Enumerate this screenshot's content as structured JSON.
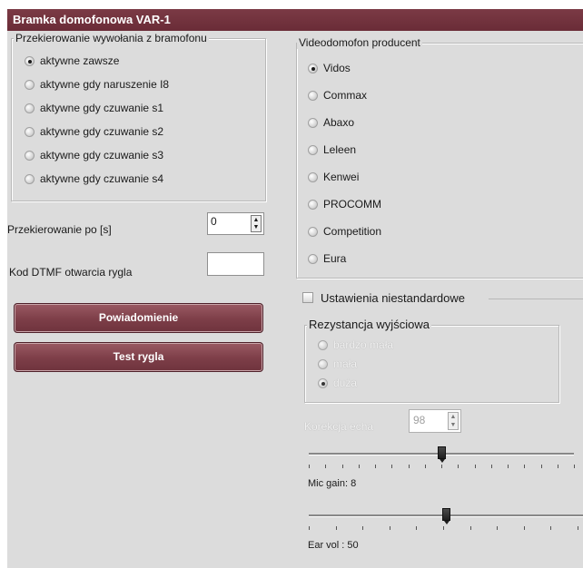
{
  "window": {
    "title": "Bramka domofonowa VAR-1"
  },
  "forwarding": {
    "legend": "Przekierowanie wywołania z bramofonu",
    "options": [
      {
        "label": "aktywne zawsze",
        "selected": true
      },
      {
        "label": "aktywne gdy naruszenie I8",
        "selected": false
      },
      {
        "label": "aktywne gdy czuwanie s1",
        "selected": false
      },
      {
        "label": "aktywne gdy czuwanie s2",
        "selected": false
      },
      {
        "label": "aktywne gdy czuwanie s3",
        "selected": false
      },
      {
        "label": "aktywne gdy czuwanie s4",
        "selected": false
      }
    ]
  },
  "redirect_after": {
    "label": "Przekierowanie po [s]",
    "value": "0"
  },
  "dtmf": {
    "label": "Kod DTMF otwarcia rygla",
    "value": ""
  },
  "buttons": {
    "notification": "Powiadomienie",
    "test_lock": "Test rygla"
  },
  "producer": {
    "legend": "Videodomofon producent",
    "options": [
      {
        "label": "Vidos",
        "selected": true
      },
      {
        "label": "Commax",
        "selected": false
      },
      {
        "label": "Abaxo",
        "selected": false
      },
      {
        "label": "Leleen",
        "selected": false
      },
      {
        "label": "Kenwei",
        "selected": false
      },
      {
        "label": "PROCOMM",
        "selected": false
      },
      {
        "label": "Competition",
        "selected": false
      },
      {
        "label": "Eura",
        "selected": false
      }
    ]
  },
  "custom": {
    "checkbox_label": "Ustawienia niestandardowe",
    "checked": false,
    "resistance": {
      "legend": "Rezystancja wyjściowa",
      "options": [
        {
          "label": "bardzo mała",
          "selected": false
        },
        {
          "label": "mała",
          "selected": false
        },
        {
          "label": "duża",
          "selected": true
        }
      ]
    },
    "echo": {
      "label": "Korekcja echa",
      "value": "98"
    },
    "mic_gain": {
      "label": "Mic gain: 8",
      "level_fraction": 0.5
    },
    "ear_vol": {
      "label": "Ear vol : 50",
      "level_fraction": 0.5
    }
  }
}
